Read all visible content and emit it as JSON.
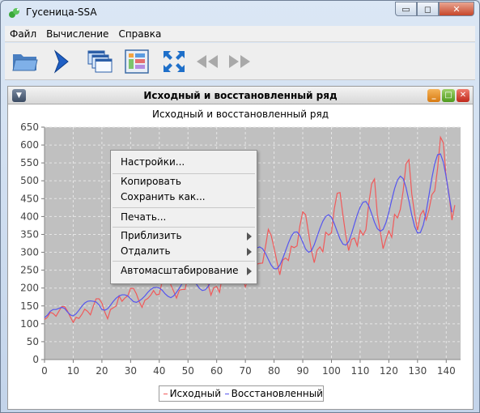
{
  "window": {
    "title": "Гусеница-SSA",
    "min_glyph": "▭",
    "max_glyph": "◻",
    "close_glyph": "✕"
  },
  "menubar": [
    "Файл",
    "Вычисление",
    "Справка"
  ],
  "toolbar": [
    "open-folder-icon",
    "run-arrow-icon",
    "windows-cascade-icon",
    "panels-layout-icon",
    "expand-arrows-icon",
    "back-double-arrow-icon",
    "forward-double-arrow-icon"
  ],
  "frame": {
    "title": "Исходный и восстановленный ряд",
    "menu_glyph": "▼",
    "min_glyph": "_",
    "max_glyph": "□",
    "close_glyph": "✕"
  },
  "chart_data": {
    "type": "line",
    "title": "Исходный и восстановленный ряд",
    "xlim": [
      0,
      145
    ],
    "ylim": [
      0,
      650
    ],
    "x_ticks": [
      0,
      10,
      20,
      30,
      40,
      50,
      60,
      70,
      80,
      90,
      100,
      110,
      120,
      130,
      140
    ],
    "y_ticks": [
      0,
      50,
      100,
      150,
      200,
      250,
      300,
      350,
      400,
      450,
      500,
      550,
      600,
      650
    ],
    "grid": true,
    "legend_position": "bottom-center",
    "series": [
      {
        "name": "Исходный",
        "color": "#f05a5a",
        "y": [
          112,
          118,
          132,
          129,
          121,
          135,
          148,
          148,
          136,
          119,
          104,
          118,
          115,
          126,
          141,
          135,
          125,
          149,
          170,
          170,
          158,
          133,
          114,
          140,
          145,
          150,
          178,
          163,
          172,
          178,
          199,
          199,
          184,
          162,
          146,
          166,
          171,
          180,
          193,
          181,
          183,
          218,
          230,
          242,
          209,
          191,
          172,
          194,
          196,
          196,
          236,
          235,
          229,
          243,
          264,
          272,
          237,
          211,
          180,
          201,
          204,
          188,
          235,
          227,
          234,
          264,
          302,
          293,
          259,
          229,
          203,
          229,
          242,
          233,
          267,
          269,
          270,
          315,
          364,
          347,
          312,
          274,
          237,
          278,
          284,
          277,
          317,
          313,
          318,
          374,
          413,
          405,
          355,
          306,
          271,
          306,
          315,
          301,
          356,
          348,
          355,
          422,
          465,
          467,
          404,
          347,
          305,
          336,
          340,
          318,
          362,
          348,
          363,
          435,
          491,
          505,
          404,
          359,
          310,
          337,
          360,
          342,
          406,
          396,
          420,
          472,
          548,
          559,
          463,
          407,
          362,
          405,
          417,
          391,
          419,
          461,
          472,
          535,
          622,
          606,
          508,
          461,
          390,
          432
        ]
      },
      {
        "name": "Восстановленный",
        "color": "#5555ee",
        "y": [
          117,
          124,
          135,
          140,
          140,
          143,
          146,
          143,
          133,
          125,
          122,
          128,
          138,
          149,
          158,
          163,
          164,
          163,
          161,
          153,
          140,
          138,
          142,
          152,
          163,
          172,
          178,
          181,
          181,
          178,
          170,
          162,
          160,
          164,
          170,
          178,
          188,
          196,
          201,
          202,
          200,
          194,
          184,
          177,
          173,
          178,
          188,
          200,
          213,
          222,
          227,
          226,
          220,
          210,
          199,
          193,
          195,
          204,
          218,
          232,
          243,
          252,
          258,
          258,
          250,
          238,
          227,
          222,
          226,
          238,
          253,
          270,
          287,
          302,
          312,
          315,
          310,
          297,
          280,
          264,
          254,
          254,
          264,
          282,
          304,
          326,
          345,
          356,
          357,
          347,
          328,
          309,
          300,
          304,
          321,
          344,
          367,
          387,
          400,
          405,
          398,
          380,
          358,
          337,
          323,
          320,
          330,
          352,
          379,
          405,
          426,
          440,
          442,
          430,
          408,
          384,
          366,
          359,
          364,
          383,
          412,
          446,
          478,
          502,
          513,
          506,
          481,
          444,
          404,
          372,
          354,
          355,
          376,
          413,
          460,
          508,
          548,
          573,
          575,
          552,
          510,
          458,
          412
        ]
      }
    ]
  },
  "context_menu": {
    "items": [
      {
        "label": "Настройки...",
        "submenu": false
      },
      {
        "label": "Копировать",
        "submenu": false
      },
      {
        "label": "Сохранить как...",
        "submenu": false
      },
      {
        "label": "Печать...",
        "submenu": false
      },
      {
        "label": "Приблизить",
        "submenu": true
      },
      {
        "label": "Отдалить",
        "submenu": true
      },
      {
        "label": "Автомасштабирование",
        "submenu": true
      }
    ]
  }
}
